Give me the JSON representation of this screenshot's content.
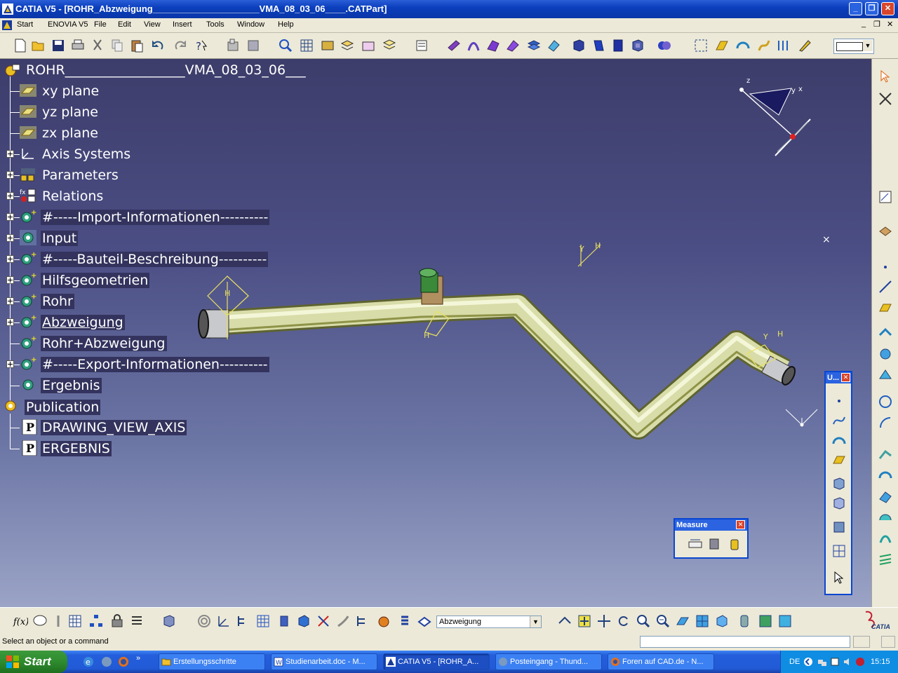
{
  "window": {
    "title": "CATIA V5 - [ROHR_Abzweigung_____________________VMA_08_03_06____.CATPart]"
  },
  "menubar": {
    "items": [
      "Start",
      "ENOVIA V5",
      "File",
      "Edit",
      "View",
      "Insert",
      "Tools",
      "Window",
      "Help"
    ]
  },
  "tree": {
    "root": "ROHR__________________VMA_08_03_06___",
    "items": [
      {
        "label": "xy plane",
        "icon": "plane-icon"
      },
      {
        "label": "yz plane",
        "icon": "plane-icon"
      },
      {
        "label": "zx plane",
        "icon": "plane-icon"
      },
      {
        "label": "Axis Systems",
        "icon": "axis-system-icon"
      },
      {
        "label": "Parameters",
        "icon": "parameters-icon"
      },
      {
        "label": "Relations",
        "icon": "relations-icon"
      },
      {
        "label": "#-----Import-Informationen----------",
        "icon": "geometrical-set-icon"
      },
      {
        "label": "Input",
        "icon": "geometrical-set-icon"
      },
      {
        "label": "#-----Bauteil-Beschreibung----------",
        "icon": "geometrical-set-icon"
      },
      {
        "label": "Hilfsgeometrien",
        "icon": "geometrical-set-icon"
      },
      {
        "label": "Rohr",
        "icon": "geometrical-set-icon"
      },
      {
        "label": "Abzweigung",
        "icon": "geometrical-set-icon"
      },
      {
        "label": "Rohr+Abzweigung",
        "icon": "geometrical-set-icon"
      },
      {
        "label": "#-----Export-Informationen----------",
        "icon": "geometrical-set-icon"
      },
      {
        "label": "Ergebnis",
        "icon": "geometrical-set-icon"
      }
    ],
    "publication": "Publication",
    "publications": [
      "DRAWING_VIEW_AXIS",
      "ERGEBNIS"
    ]
  },
  "measure_panel": {
    "title": "Measure"
  },
  "user_panel": {
    "title": "U..."
  },
  "bottom": {
    "current_set": "Abzweigung"
  },
  "status": {
    "text": "Select an object or a command"
  },
  "taskbar": {
    "start": "Start",
    "tasks": [
      "Erstellungsschritte",
      "Studienarbeit.doc - M...",
      "CATIA V5 - [ROHR_A...",
      "Posteingang - Thund...",
      "Foren auf CAD.de - N..."
    ],
    "lang": "DE",
    "clock": "15:15"
  },
  "brand": {
    "logo_text": "CATIA"
  },
  "colors": {
    "accent": "#2b63e0",
    "viewport_top": "#3d3d6b",
    "pipe": "#d8dca8",
    "highlight": "#33335e"
  }
}
